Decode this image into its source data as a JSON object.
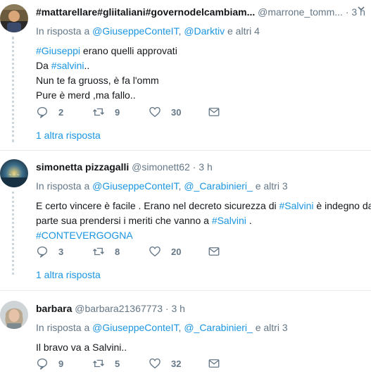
{
  "tweets": [
    {
      "fullname": "#mattarellare#gliitaliani#governodelcambiam...",
      "username": "@marrone_tomm...",
      "dot": "·",
      "time": "3 h",
      "reply_prefix": "In risposta a",
      "reply_mentions": [
        "@GiuseppeConteIT",
        "@Darktiv"
      ],
      "reply_suffix": "e altri 4",
      "lines": [
        {
          "hashtag": "#Giuseppi",
          "rest": " erano quelli approvati"
        },
        {
          "text": "Da ",
          "hashtag": "#salvini",
          "rest": ".."
        },
        {
          "text": "Nun te fa gruoss, è fa l'omm"
        },
        {
          "text": "Pure è merd ,ma  fallo.."
        }
      ],
      "replies": "2",
      "retweets": "9",
      "likes": "30",
      "more_replies": "1 altra risposta"
    },
    {
      "fullname": "simonetta pizzagalli",
      "username": "@simonett62",
      "dot": "·",
      "time": "3 h",
      "reply_prefix": "In risposta a",
      "reply_mentions": [
        "@GiuseppeConteIT",
        "@_Carabinieri_"
      ],
      "reply_suffix": "e altri 3",
      "lines": [
        {
          "text": "E certo vincere è facile . Erano nel decreto sicurezza di ",
          "hashtag": "#Salvini",
          "rest": "  è indegno da"
        },
        {
          "text": "parte sua prendersi i meriti che vanno a ",
          "hashtag": "#Salvini",
          "rest": " ."
        },
        {
          "hashtag": "#CONTEVERGOGNA"
        }
      ],
      "replies": "3",
      "retweets": "8",
      "likes": "20",
      "more_replies": "1 altra risposta"
    },
    {
      "fullname": "barbara",
      "username": "@barbara21367773",
      "dot": "·",
      "time": "3 h",
      "reply_prefix": "In risposta a",
      "reply_mentions": [
        "@GiuseppeConteIT",
        "@_Carabinieri_"
      ],
      "reply_suffix": "e altri 3",
      "lines": [
        {
          "text": "Il bravo va a Salvini.."
        }
      ],
      "replies": "9",
      "retweets": "5",
      "likes": "32"
    }
  ],
  "colors": {
    "link": "#1b95e0",
    "muted": "#657786",
    "text": "#14171a",
    "divider": "#e6ecf0",
    "thread_line": "#ccd6dd"
  },
  "icons": [
    "reply-icon",
    "retweet-icon",
    "like-icon",
    "direct-message-icon",
    "caret-down-icon"
  ]
}
